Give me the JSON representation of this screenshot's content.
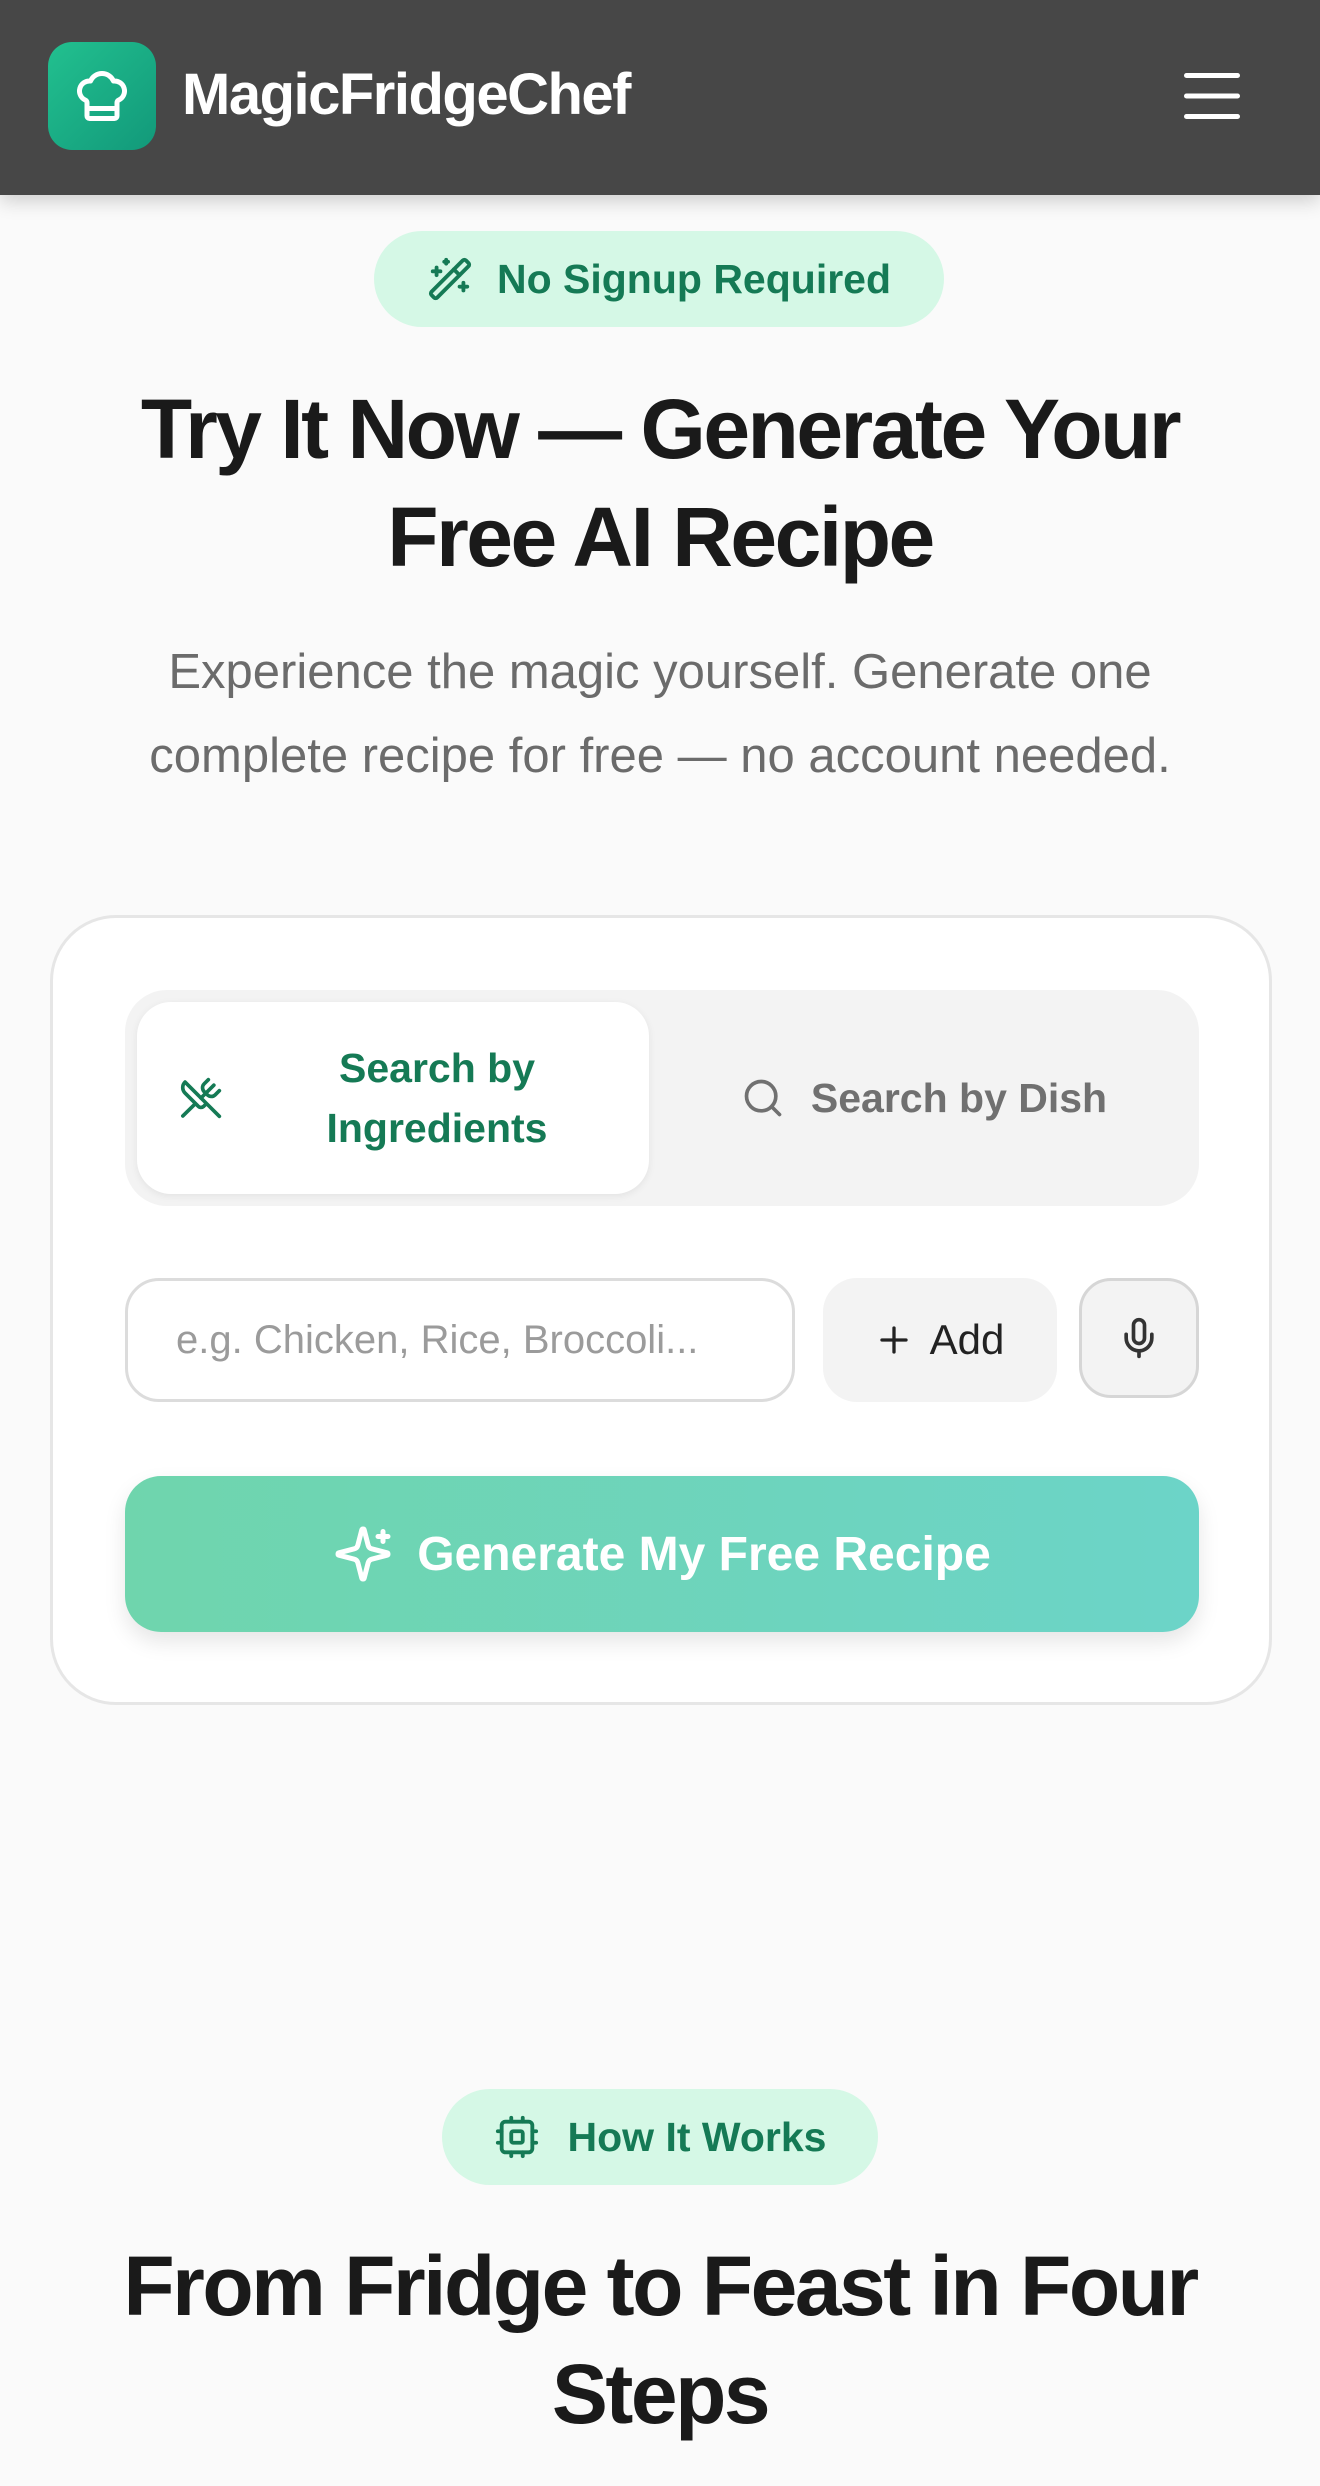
{
  "header": {
    "brand": "MagicFridgeChef",
    "logo_icon": "chef-hat-icon",
    "menu_icon": "hamburger-menu-icon"
  },
  "hero": {
    "badge_icon": "magic-wand-icon",
    "badge": "No Signup Required",
    "title": "Try It Now — Generate Your Free AI Recipe",
    "subtitle": "Experience the magic yourself. Generate one complete recipe for free — no account needed."
  },
  "search_card": {
    "tabs": [
      {
        "label": "Search by Ingredients",
        "icon": "utensils-crossed-icon",
        "active": true
      },
      {
        "label": "Search by Dish",
        "icon": "search-icon",
        "active": false
      }
    ],
    "input": {
      "placeholder": "e.g. Chicken, Rice, Broccoli...",
      "value": ""
    },
    "add_button": "Add",
    "mic_icon": "microphone-icon",
    "generate_button": "Generate My Free Recipe",
    "generate_icon": "sparkles-icon"
  },
  "how_it_works": {
    "badge_icon": "cpu-chip-icon",
    "badge": "How It Works",
    "title": "From Fridge to Feast in Four Steps"
  },
  "colors": {
    "header_bg": "#474747",
    "brand_green": "#157a55",
    "badge_bg": "#d5f8e6",
    "logo_gradient_start": "#22c08f",
    "logo_gradient_end": "#12997a",
    "generate_gradient_start": "#6fd5ad",
    "generate_gradient_end": "#6cd4c8"
  }
}
